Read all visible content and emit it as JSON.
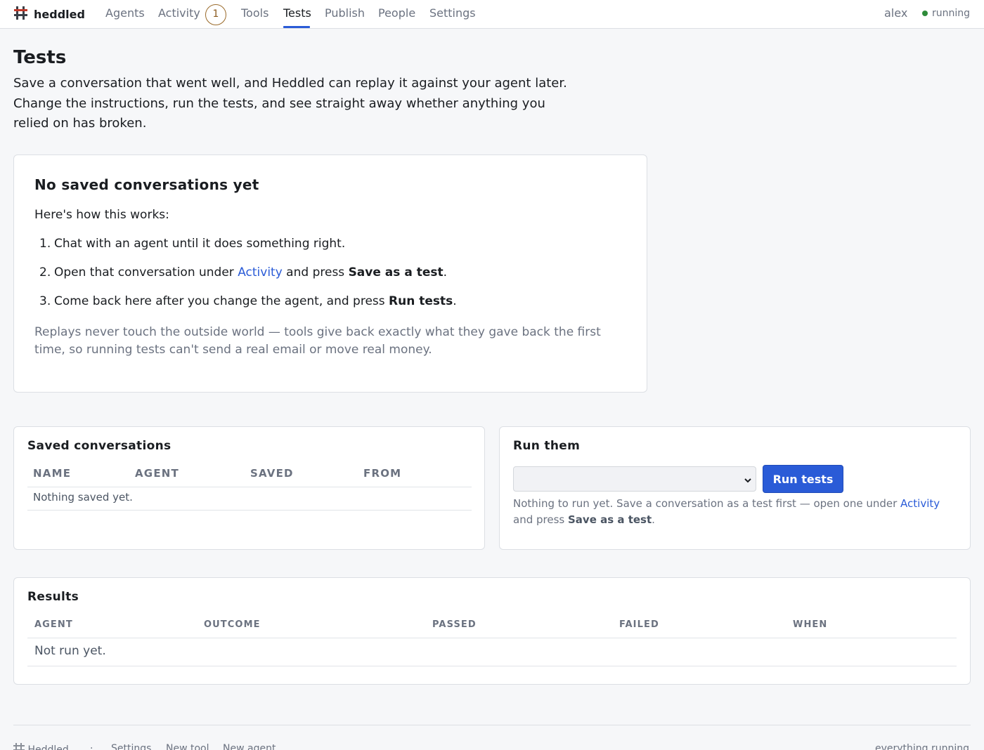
{
  "nav": {
    "brand": "heddled",
    "items": [
      {
        "label": "Agents"
      },
      {
        "label": "Activity",
        "badge": "1"
      },
      {
        "label": "Tools"
      },
      {
        "label": "Tests",
        "active": true
      },
      {
        "label": "Publish"
      },
      {
        "label": "People"
      },
      {
        "label": "Settings"
      }
    ],
    "user": "alex",
    "status": "running",
    "status_color": "#2e8b3a"
  },
  "page": {
    "title": "Tests",
    "intro": "Save a conversation that went well, and Heddled can replay it against your agent later. Change the instructions, run the tests, and see straight away whether anything you relied on has broken."
  },
  "empty_state": {
    "title": "No saved conversations yet",
    "how": "Here's how this works:",
    "steps": [
      {
        "num": "1.",
        "text": "Chat with an agent until it does something right."
      },
      {
        "num": "2.",
        "pre": "Open that conversation under ",
        "link": "Activity",
        "mid": " and press ",
        "bold": "Save as a test",
        "post": "."
      },
      {
        "num": "3.",
        "pre": "Come back here after you change the agent, and press ",
        "bold": "Run tests",
        "post": "."
      }
    ],
    "note": "Replays never touch the outside world — tools give back exactly what they gave back the first time, so running tests can't send a real email or move real money."
  },
  "saved": {
    "title": "Saved conversations",
    "columns": [
      "NAME",
      "AGENT",
      "SAVED",
      "FROM"
    ],
    "empty": "Nothing saved yet."
  },
  "run": {
    "title": "Run them",
    "select_value": "",
    "button": "Run tests",
    "note_pre": "Nothing to run yet. Save a conversation as a test first — open one under ",
    "note_link": "Activity",
    "note_mid": " and press ",
    "note_bold": "Save as a test",
    "note_post": "."
  },
  "results": {
    "title": "Results",
    "columns": [
      "AGENT",
      "OUTCOME",
      "PASSED",
      "FAILED",
      "WHEN"
    ],
    "empty": "Not run yet."
  },
  "footer": {
    "brand": "Heddled",
    "sep": "·",
    "links": [
      "Settings",
      "New tool",
      "New agent"
    ],
    "status": "everything running"
  },
  "colors": {
    "accent": "#2a5bd7",
    "badge": "#9a6a2a"
  }
}
